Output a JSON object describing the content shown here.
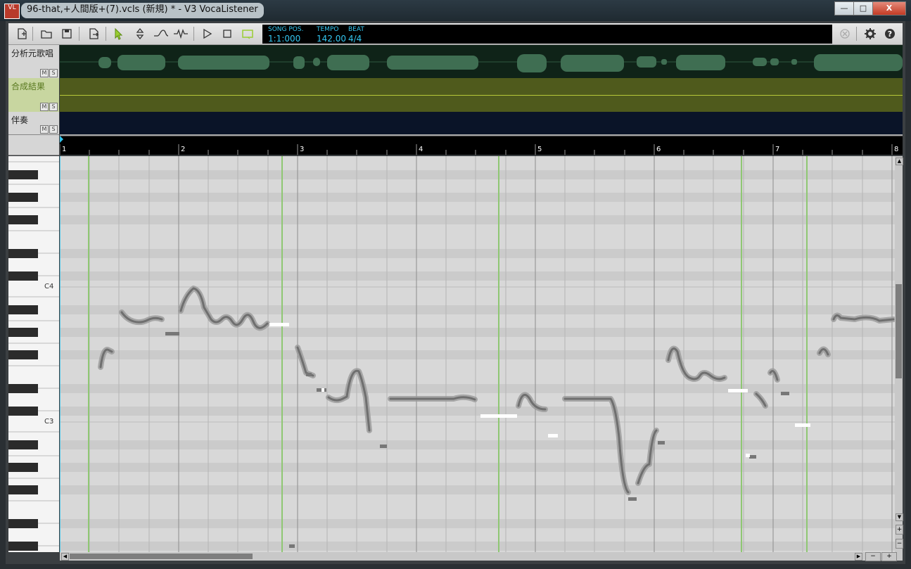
{
  "window": {
    "title": "96-that,+人間版+(7).vcls (新規) * - V3 VocaListener",
    "app_icon_text": "VL",
    "minimize": "—",
    "maximize": "□",
    "close": "X"
  },
  "toolbar": {
    "icons": [
      "new-file-icon",
      "open-folder-icon",
      "save-icon",
      "export-icon",
      "select-arrow-icon",
      "pitch-updown-icon",
      "curve-icon",
      "vibrato-icon",
      "play-icon",
      "stop-icon",
      "loop-icon"
    ],
    "accent": "#33c6f0"
  },
  "display": {
    "song_pos_label": "SONG POS.",
    "song_pos_value": "1:1:000",
    "tempo_label": "TEMPO",
    "tempo_value": "142.00",
    "beat_label": "BEAT",
    "beat_value": "4/4"
  },
  "tracks": [
    {
      "name": "分析元歌唱",
      "m": "M",
      "s": "S",
      "color": "#0f2318"
    },
    {
      "name": "合成結果",
      "m": "M",
      "s": "S",
      "color": "#4f5a1c"
    },
    {
      "name": "伴奏",
      "m": "M",
      "s": "S",
      "color": "#0a1428"
    }
  ],
  "ruler": {
    "bars": [
      "1",
      "2",
      "3",
      "4",
      "5",
      "6",
      "7",
      "8"
    ]
  },
  "piano": {
    "labels": [
      "C4",
      "C3"
    ]
  },
  "scroll": {
    "plus": "+",
    "minus": "−"
  }
}
